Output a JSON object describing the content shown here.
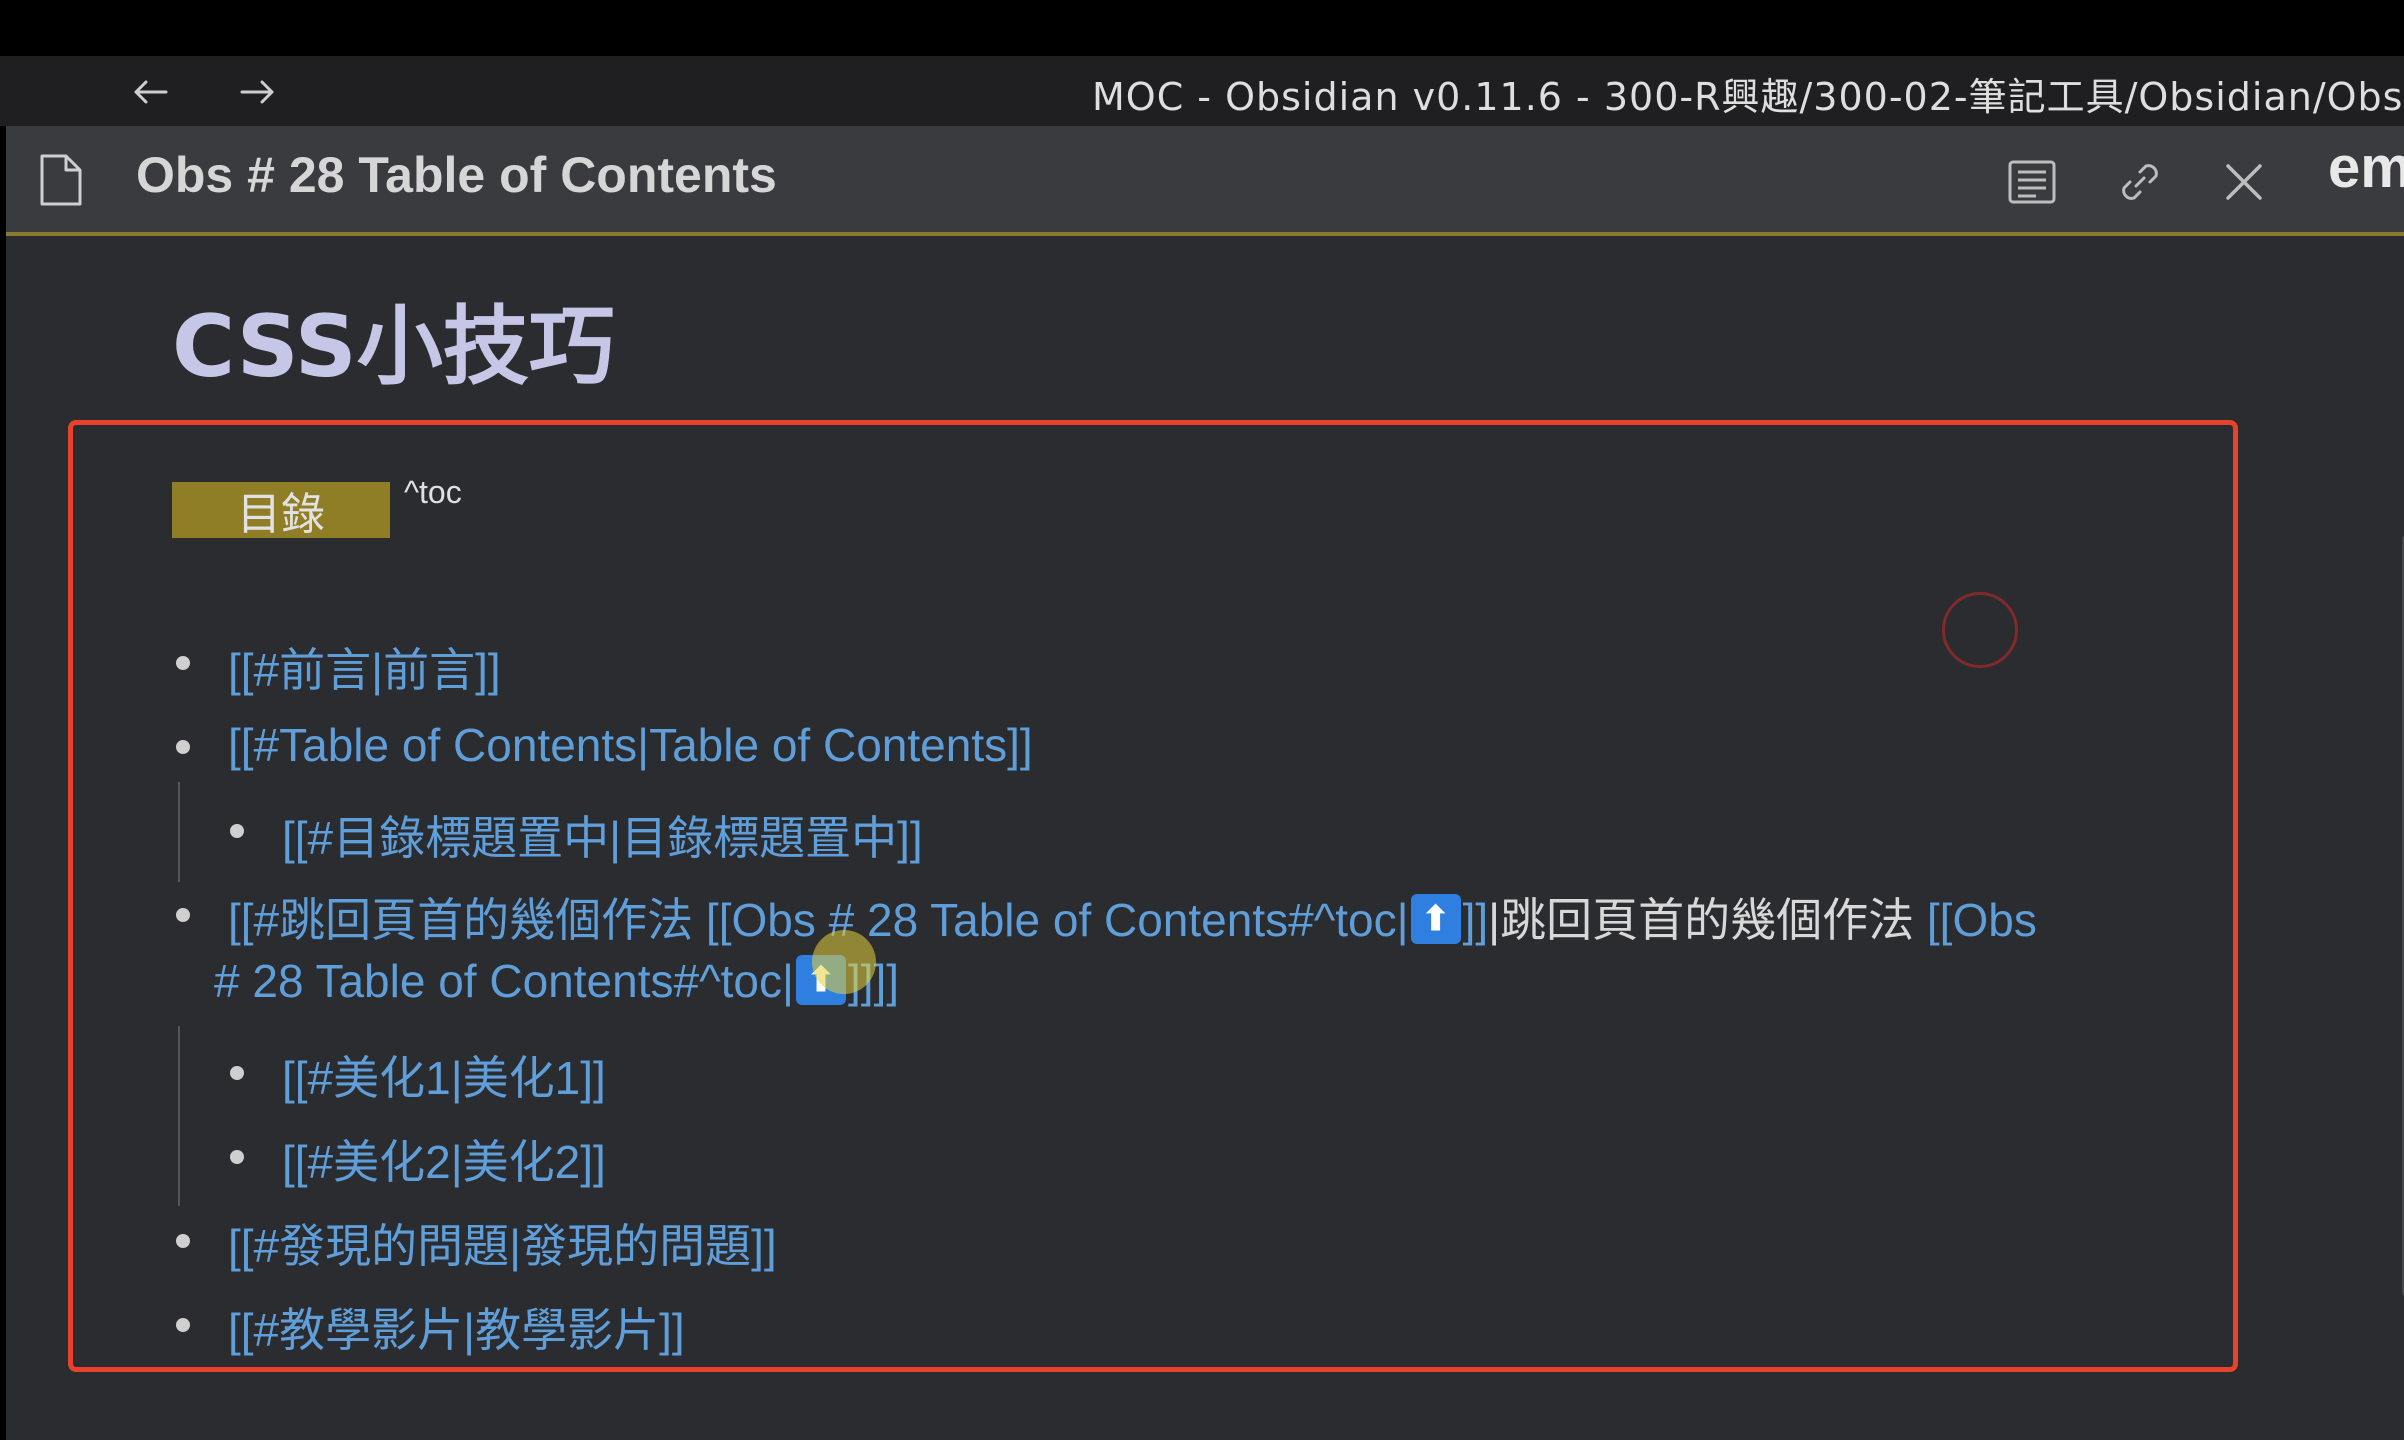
{
  "window": {
    "title": "MOC - Obsidian v0.11.6 - 300-R興趣/300-02-筆記工具/Obsidian/Obs",
    "back_icon": "←",
    "forward_icon": "→"
  },
  "pane": {
    "title": "Obs # 28 Table of Contents",
    "cut_text": "em"
  },
  "note": {
    "heading": "CSS小技巧",
    "toc_label": "目錄",
    "toc_anchor": "^toc",
    "up_glyph": "⬆",
    "items": [
      {
        "text": "[[#前言|前言]]"
      },
      {
        "text": "[[#Table of Contents|Table of Contents]]"
      },
      {
        "text": "[[#目錄標題置中|目錄標題置中]]"
      },
      {
        "part1": "[[#跳回頁首的幾個作法 [[Obs # 28 Table of Contents#^toc|",
        "part2": "]]",
        "part3": "|跳回頁首的幾個作法 ",
        "part4": "[[Obs",
        "line2_part1": "# 28 Table of Contents#^toc|",
        "line2_part2": "]]]]"
      },
      {
        "text": "[[#美化1|美化1]]"
      },
      {
        "text": "[[#美化2|美化2]]"
      },
      {
        "text": "[[#發現的問題|發現的問題]]"
      },
      {
        "text": "[[#教學影片|教學影片]]"
      }
    ]
  },
  "colors": {
    "link": "#5f9ed8",
    "heading": "#c6c6e6",
    "toc_badge": "#8f7e25",
    "highlight_border": "#e8412e",
    "up_button": "#2f7fe0"
  }
}
